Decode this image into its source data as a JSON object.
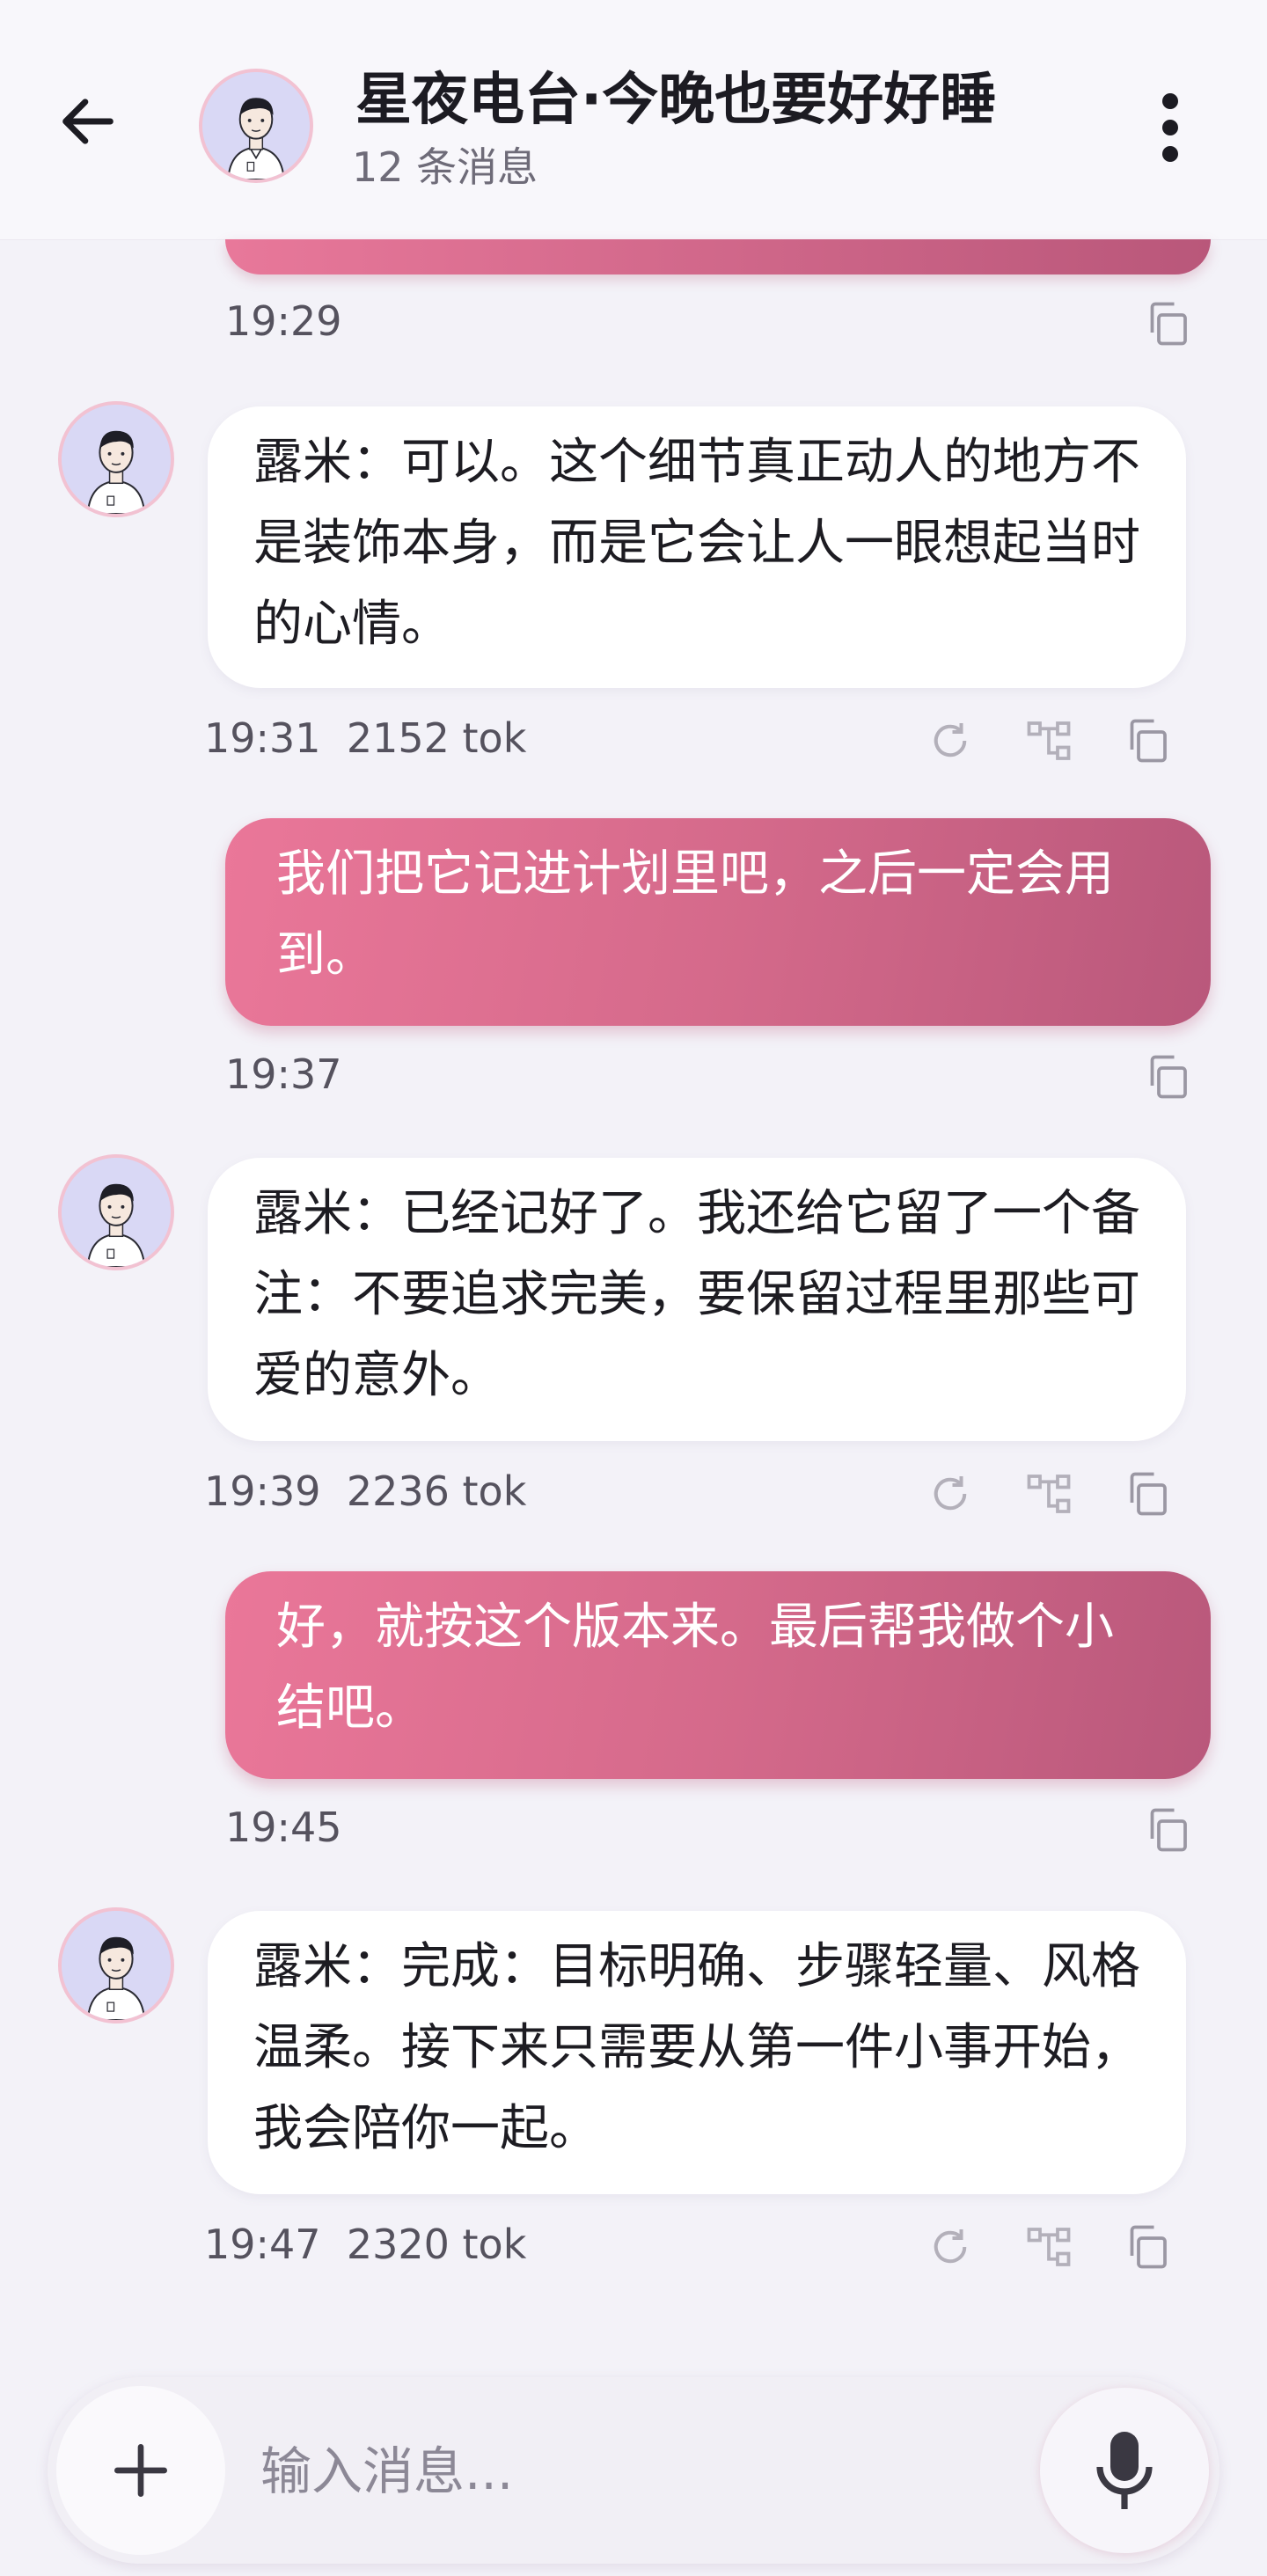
{
  "header": {
    "title": "星夜电台·今晚也要好好睡",
    "subtitle": "12 条消息"
  },
  "messages": [
    {
      "role": "user-partial",
      "time": "19:29"
    },
    {
      "role": "bot",
      "text": "露米：可以。这个细节真正动人的地方不是装饰本身，而是它会让人一眼想起当时的心情。",
      "time": "19:31",
      "tokens": "2152 tok"
    },
    {
      "role": "user",
      "text": "我们把它记进计划里吧，之后一定会用到。",
      "time": "19:37"
    },
    {
      "role": "bot",
      "text": "露米：已经记好了。我还给它留了一个备注：不要追求完美，要保留过程里那些可爱的意外。",
      "time": "19:39",
      "tokens": "2236 tok"
    },
    {
      "role": "user",
      "text": "好，就按这个版本来。最后帮我做个小结吧。",
      "time": "19:45"
    },
    {
      "role": "bot",
      "text": "露米：完成：目标明确、步骤轻量、风格温柔。接下来只需要从第一件小事开始，我会陪你一起。",
      "time": "19:47",
      "tokens": "2320 tok"
    }
  ],
  "composer": {
    "placeholder": "输入消息..."
  },
  "icons": {
    "back": "back-arrow-icon",
    "more": "more-vertical-icon",
    "copy": "copy-icon",
    "regenerate": "refresh-icon",
    "branch": "branch-icon",
    "add": "plus-icon",
    "mic": "mic-icon"
  },
  "colors": {
    "user_bubble_start": "#ea7799",
    "user_bubble_end": "#b9587b",
    "bot_bubble": "#ffffff",
    "background": "#f3f2f8"
  }
}
